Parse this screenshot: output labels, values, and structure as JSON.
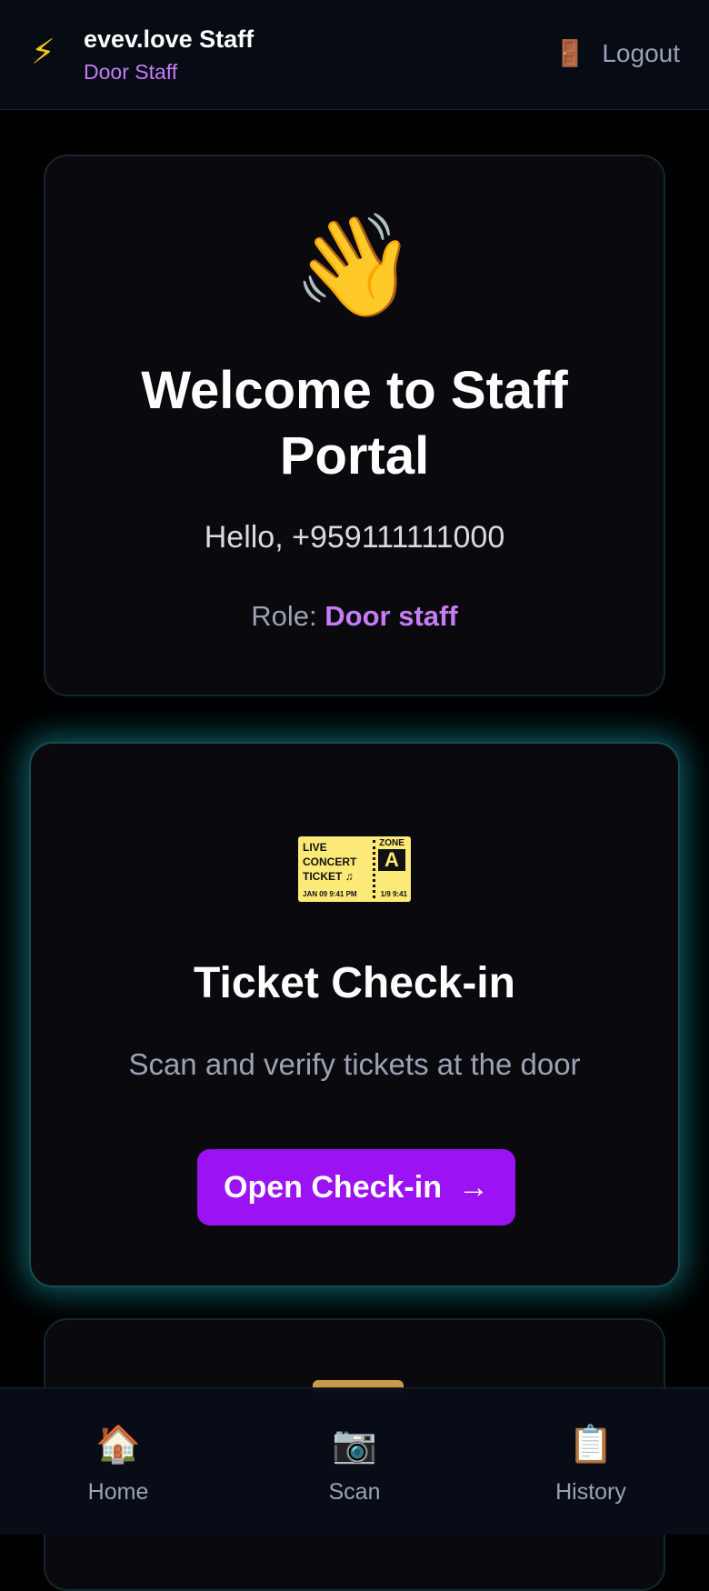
{
  "header": {
    "title": "evev.love Staff",
    "subtitle": "Door Staff",
    "logout_label": "Logout",
    "brand_icon": "lightning-icon",
    "logout_icon": "door-icon"
  },
  "welcome": {
    "emoji": "👋",
    "title": "Welcome to Staff Portal",
    "greeting": "Hello, +959111111000",
    "role_label": "Role:",
    "role_value": "Door staff"
  },
  "checkin": {
    "ticket_icon": {
      "line1": "LIVE",
      "line2": "CONCERT",
      "line3": "TICKET ♫",
      "zone_label": "ZONE",
      "zone_value": "A",
      "date_time": "JAN 09   9:41 PM",
      "seat_time": "1/9  9:41"
    },
    "title": "Ticket Check-in",
    "description": "Scan and verify tickets at the door",
    "button_label": "Open Check-in",
    "button_arrow": "→"
  },
  "bottom_nav": {
    "items": [
      {
        "label": "Home",
        "icon": "🏠"
      },
      {
        "label": "Scan",
        "icon": "📷"
      },
      {
        "label": "History",
        "icon": "📋"
      }
    ]
  },
  "colors": {
    "accent": "#9b12f4",
    "role_text": "#c47cf7",
    "glow": "#14aab4"
  }
}
